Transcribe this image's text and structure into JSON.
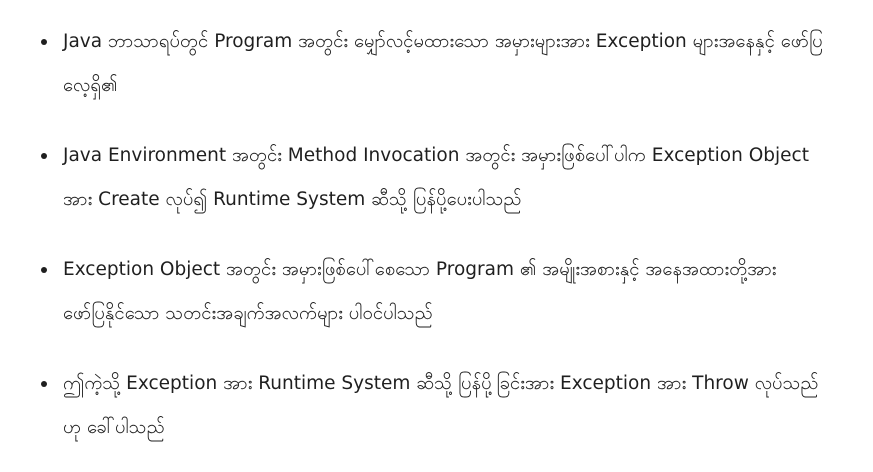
{
  "list": {
    "items": [
      {
        "text": "Java ဘာသာရပ်တွင် Program အတွင်း မျှော်လင့်မထားသော အမှားများအား Exception များအနေနှင့် ဖော်ပြလေ့ရှိ၏"
      },
      {
        "text": "Java Environment အတွင်း Method Invocation အတွင်း အမှားဖြစ်ပေါ်ပါက Exception Object အား Create လုပ်၍ Runtime System ဆီသို့ ပြန်ပို့ပေးပါသည်"
      },
      {
        "text": "Exception Object အတွင်း အမှားဖြစ်ပေါ်စေသော Program ၏ အမျိုးအစားနှင့် အနေအထားတို့အား ဖော်ပြနိုင်သော သတင်းအချက်အလက်များ ပါဝင်ပါသည်"
      },
      {
        "text": "ဤကဲ့သို့ Exception အား Runtime System ဆီသို့ ပြန်ပို့ခြင်းအား Exception အား Throw လုပ်သည်ဟု ခေါ်ပါသည်"
      }
    ]
  }
}
